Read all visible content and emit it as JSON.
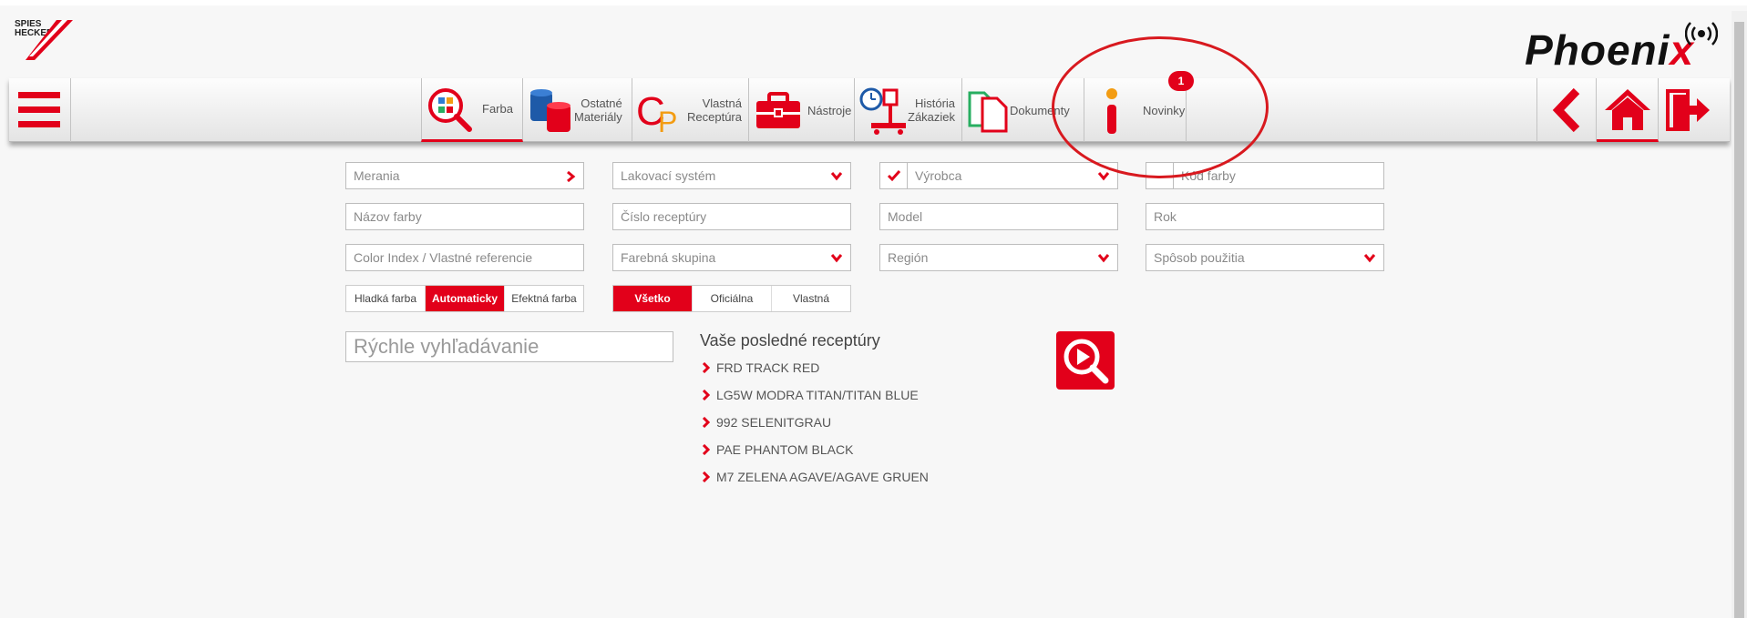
{
  "logo": {
    "line1": "SPIES",
    "line2": "HECKER"
  },
  "brand": {
    "main": "Phoeni",
    "x": "x"
  },
  "nav": {
    "farba": "Farba",
    "ostatne": [
      "Ostatné",
      "Materiály"
    ],
    "vlastna": [
      "Vlastná",
      "Receptúra"
    ],
    "nastroje": "Nástroje",
    "historia": [
      "História",
      "Zákaziek"
    ],
    "dokumenty": "Dokumenty",
    "novinky": "Novinky",
    "novinky_badge": "1"
  },
  "form": {
    "merania": "Merania",
    "lakovaci": "Lakovací systém",
    "vyrobca": "Výrobca",
    "kod": "Kód farby",
    "nazov": "Názov farby",
    "cislo": "Číslo receptúry",
    "model": "Model",
    "rok": "Rok",
    "color_index": "Color Index / Vlastné referencie",
    "farebna": "Farebná skupina",
    "region": "Región",
    "sposob": "Spôsob použitia"
  },
  "seg1": [
    "Hladká farba",
    "Automaticky",
    "Efektná farba"
  ],
  "seg2": [
    "Všetko",
    "Oficiálna",
    "Vlastná"
  ],
  "quick_placeholder": "Rýchle vyhľadávanie",
  "recent": {
    "title": "Vaše posledné receptúry",
    "items": [
      "FRD TRACK RED",
      "LG5W MODRA TITAN/TITAN BLUE",
      "992 SELENITGRAU",
      "PAE PHANTOM BLACK",
      "M7 ZELENA AGAVE/AGAVE GRUEN"
    ]
  },
  "colors": {
    "accent": "#e2001a"
  }
}
